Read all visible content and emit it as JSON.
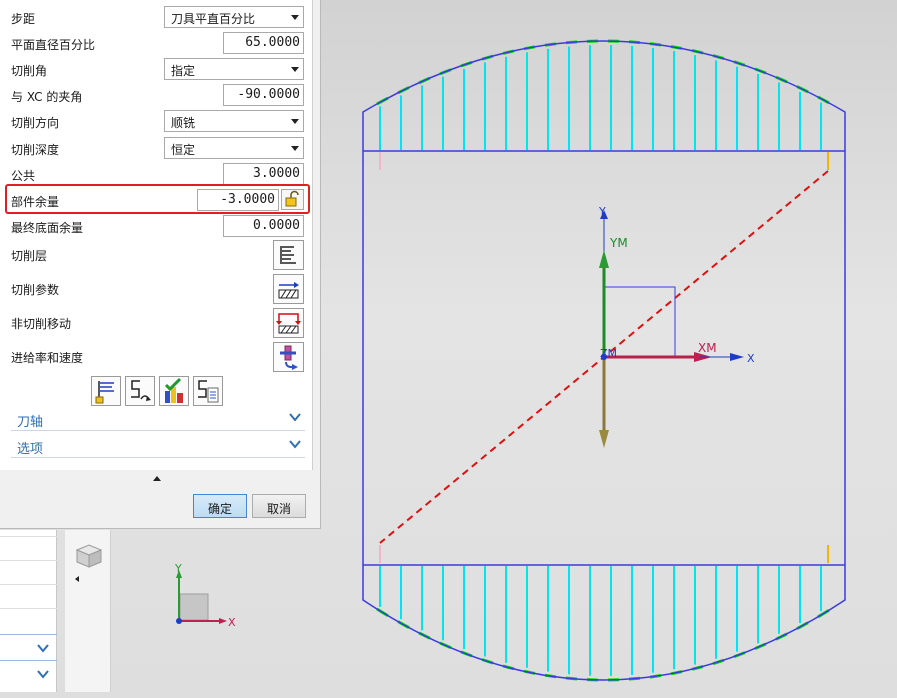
{
  "params": {
    "stepover": {
      "label": "步距",
      "value": "刀具平直百分比"
    },
    "flat_diameter_percent": {
      "label": "平面直径百分比",
      "value": "65.0000"
    },
    "cut_angle": {
      "label": "切削角",
      "value": "指定"
    },
    "angle_from_xc": {
      "label": "与 XC 的夹角",
      "value": "-90.0000"
    },
    "cut_direction": {
      "label": "切削方向",
      "value": "顺铣"
    },
    "cut_depth": {
      "label": "切削深度",
      "value": "恒定"
    },
    "common": {
      "label": "公共",
      "value": "3.0000"
    },
    "part_stock": {
      "label": "部件余量",
      "value": "-3.0000"
    },
    "final_floor_stock": {
      "label": "最终底面余量",
      "value": "0.0000"
    }
  },
  "tool_rows": {
    "cut_levels": "切削层",
    "cut_parameters": "切削参数",
    "non_cutting_moves": "非切削移动",
    "feeds_speeds": "进给率和速度"
  },
  "sections": {
    "tool_axis": "刀轴",
    "options": "选项"
  },
  "footer": {
    "ok": "确定",
    "cancel": "取消"
  },
  "viewport": {
    "axis_labels": {
      "y": "Y",
      "ym": "YM",
      "zm": "ZM",
      "xm": "XM",
      "x": "X"
    },
    "triad_labels": {
      "y": "Y",
      "x": "X"
    }
  },
  "colors": {
    "highlight": "#e02020",
    "accent_blue": "#2f6fb3",
    "toolpath_cyan": "#00e5ee",
    "boundary_blue": "#3a3ae0",
    "engage_green": "#00dd00",
    "diagonal_red": "#e01010"
  }
}
